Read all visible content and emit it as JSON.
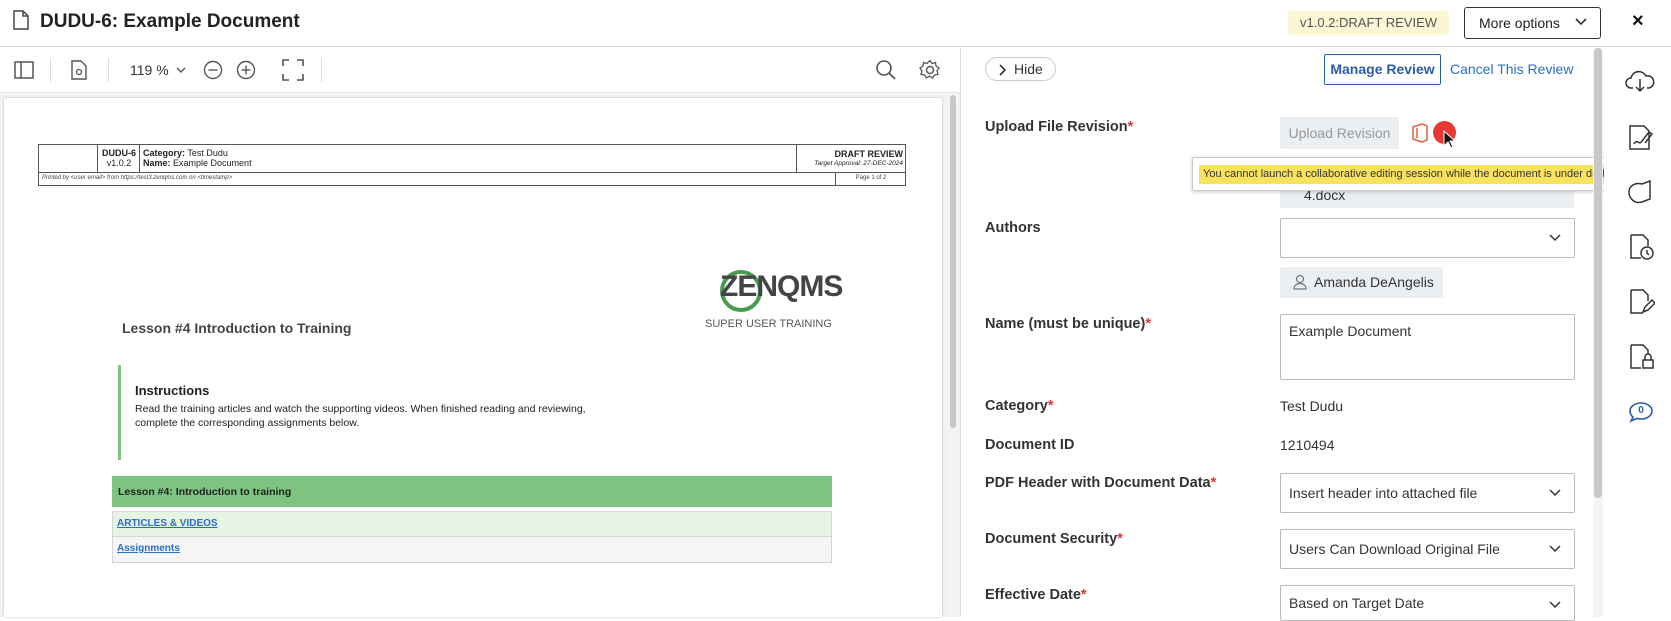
{
  "header": {
    "title": "DUDU-6: Example Document",
    "version_badge": "v1.0.2:DRAFT REVIEW",
    "more_options": "More options",
    "close": "×"
  },
  "toolbar": {
    "zoom": "119",
    "zoom_unit": "%"
  },
  "pdf": {
    "doc_id": "DUDU-6",
    "doc_version": "v1.0.2",
    "category_label": "Category:",
    "category_value": "Test Dudu",
    "name_label": "Name:",
    "name_value": "Example Document",
    "status": "DRAFT REVIEW",
    "target_approval": "Target Approval: 27-DEC-2024",
    "printed_by": "Printed by <user email> from https://test3.zenqms.com on <timestamp>",
    "page": "Page 1 of 2",
    "logo_a": "ZEN",
    "logo_b": "Q",
    "logo_c": "MS",
    "super_user": "SUPER USER TRAINING",
    "lesson_title": "Lesson #4 Introduction to Training",
    "instructions_heading": "Instructions",
    "instructions_body": "Read the training articles and watch the supporting videos. When finished reading and reviewing, complete the corresponding assignments below.",
    "table_header": "Lesson #4: Introduction to training",
    "link_articles": "ARTICLES & VIDEOS",
    "link_assignments": "Assignments"
  },
  "panel": {
    "hide": "Hide",
    "manage_review": "Manage Review",
    "cancel_review": "Cancel This Review",
    "upload_label": "Upload File Revision",
    "upload_button": "Upload Revision",
    "tooltip": "You cannot launch a collaborative editing session while the document is under draft review.",
    "file_name": "4.docx",
    "authors_label": "Authors",
    "author_chip": "Amanda DeAngelis",
    "name_label": "Name (must be unique)",
    "name_value": "Example Document",
    "category_label": "Category",
    "category_value": "Test Dudu",
    "docid_label": "Document ID",
    "docid_value": "1210494",
    "pdfheader_label": "PDF Header with Document Data",
    "pdfheader_value": "Insert header into attached file",
    "security_label": "Document Security",
    "security_value": "Users Can Download Original File",
    "effective_label": "Effective Date",
    "effective_value": "Based on Target Date",
    "required_mark": "*"
  },
  "rail": {
    "comments_count": "0"
  },
  "colors": {
    "accent": "#2a5ea8",
    "link": "#2a6ec7",
    "green_band": "#7cc47f",
    "badge_bg": "#fbf6d4",
    "tooltip_bg": "#fae25e",
    "red": "#e53935"
  }
}
